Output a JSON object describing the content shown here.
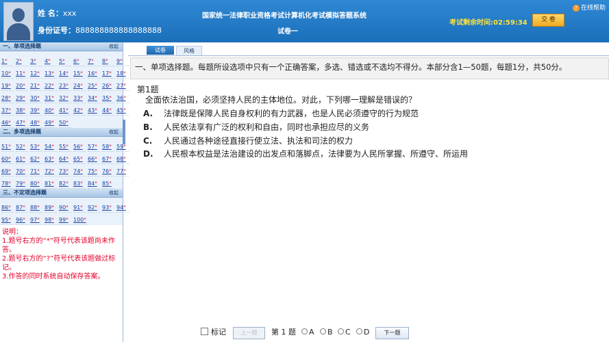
{
  "header": {
    "name_label": "姓 名：",
    "name_value": "xxx",
    "id_label": "身份证号：",
    "id_value": "888888888888888888",
    "system_title": "国家统一法律职业资格考试计算机化考试模拟答题系统",
    "paper_name": "试卷一",
    "timer_label": "考试剩余时间:",
    "timer_value": "02:59:34",
    "submit_label": "交 卷",
    "help_label": "在线帮助"
  },
  "sidebar": {
    "collapse_label": "收起",
    "sections": [
      {
        "title": "一、单项选择题",
        "rows": [
          [
            "1",
            "2",
            "3",
            "4",
            "5",
            "6",
            "7",
            "8",
            "9"
          ],
          [
            "10",
            "11",
            "12",
            "13",
            "14",
            "15",
            "16",
            "17",
            "18"
          ],
          [
            "19",
            "20",
            "21",
            "22",
            "23",
            "24",
            "25",
            "26",
            "27"
          ],
          [
            "28",
            "29",
            "30",
            "31",
            "32",
            "33",
            "34",
            "35",
            "36"
          ],
          [
            "37",
            "38",
            "39",
            "40",
            "41",
            "42",
            "43",
            "44",
            "45"
          ],
          [
            "46",
            "47",
            "48",
            "49",
            "50"
          ]
        ]
      },
      {
        "title": "二、多项选择题",
        "rows": [
          [
            "51",
            "52",
            "53",
            "54",
            "55",
            "56",
            "57",
            "58",
            "59"
          ],
          [
            "60",
            "61",
            "62",
            "63",
            "64",
            "65",
            "66",
            "67",
            "68"
          ],
          [
            "69",
            "70",
            "71",
            "72",
            "73",
            "74",
            "75",
            "76",
            "77"
          ],
          [
            "78",
            "79",
            "80",
            "81",
            "82",
            "83",
            "84",
            "85"
          ]
        ]
      },
      {
        "title": "三、不定项选择题",
        "rows": [
          [
            "86",
            "87",
            "88",
            "89",
            "90",
            "91",
            "92",
            "93",
            "94"
          ],
          [
            "95",
            "96",
            "97",
            "98",
            "99",
            "100"
          ]
        ]
      }
    ],
    "unanswered_mark": "*",
    "notes": [
      "说明：",
      "1.题号右方的“*”符号代表该题尚未作答。",
      "2.题号右方的“?”符号代表该题做过标记。",
      "3.作答的同时系统自动保存答案。"
    ]
  },
  "tabs": {
    "paper": "试卷",
    "style": "风格"
  },
  "question": {
    "instructions": "一、单项选择题。每题所设选项中只有一个正确答案，多选、错选或不选均不得分。本部分含1—50题，每题1分，共50分。",
    "number_label": "第1题",
    "stem": "全面依法治国，必须坚持人民的主体地位。对此，下列哪一理解是错误的？",
    "options": [
      {
        "letter": "A.",
        "text": "法律既是保障人民自身权利的有力武器，也是人民必须遵守的行为规范"
      },
      {
        "letter": "B.",
        "text": "人民依法享有广泛的权利和自由，同时也承担应尽的义务"
      },
      {
        "letter": "C.",
        "text": "人民通过各种途径直接行使立法、执法和司法的权力"
      },
      {
        "letter": "D.",
        "text": "人民根本权益是法治建设的出发点和落脚点，法律要为人民所掌握、所遵守、所运用"
      }
    ]
  },
  "footer": {
    "mark_label": "标记",
    "prev_label": "上一题",
    "current_label": "第 1 题",
    "choices": [
      "A",
      "B",
      "C",
      "D"
    ],
    "next_label": "下一题"
  },
  "colors": {
    "header_blue": "#1b6fb9",
    "timer_yellow": "#ffe23a",
    "note_red": "#e4002b",
    "link_blue": "#1a3fa0"
  }
}
